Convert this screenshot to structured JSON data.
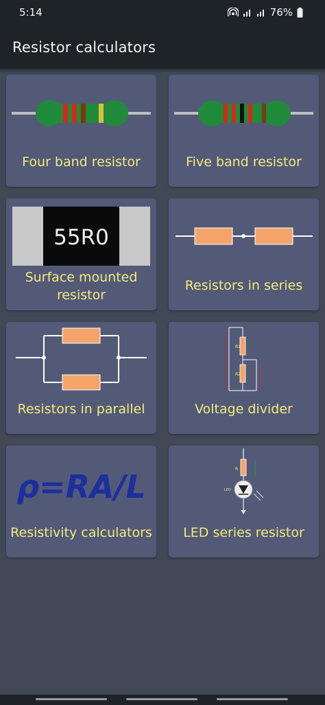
{
  "status_bar": {
    "time": "5:14",
    "battery": "76%"
  },
  "app_bar": {
    "title": "Resistor calculators"
  },
  "cards": [
    {
      "label": "Four band resistor"
    },
    {
      "label": "Five band resistor"
    },
    {
      "label": "Surface mounted\nresistor",
      "chip_text": "55R0"
    },
    {
      "label": "Resistors in series"
    },
    {
      "label": "Resistors in parallel"
    },
    {
      "label": "Voltage divider",
      "r1": "R1",
      "r2": "R2"
    },
    {
      "label": "Resistivity calculators",
      "formula": "ρ=RA/L"
    },
    {
      "label": "LED series resistor",
      "led_label": "LED",
      "r_label": "R"
    }
  ],
  "colors": {
    "background": "#414957",
    "card": "#525a78",
    "label": "#f5ea7a",
    "bars": "#1e2328",
    "resistor_body_band": "#1f8a3a",
    "resistor_series": "#f4a46a"
  }
}
